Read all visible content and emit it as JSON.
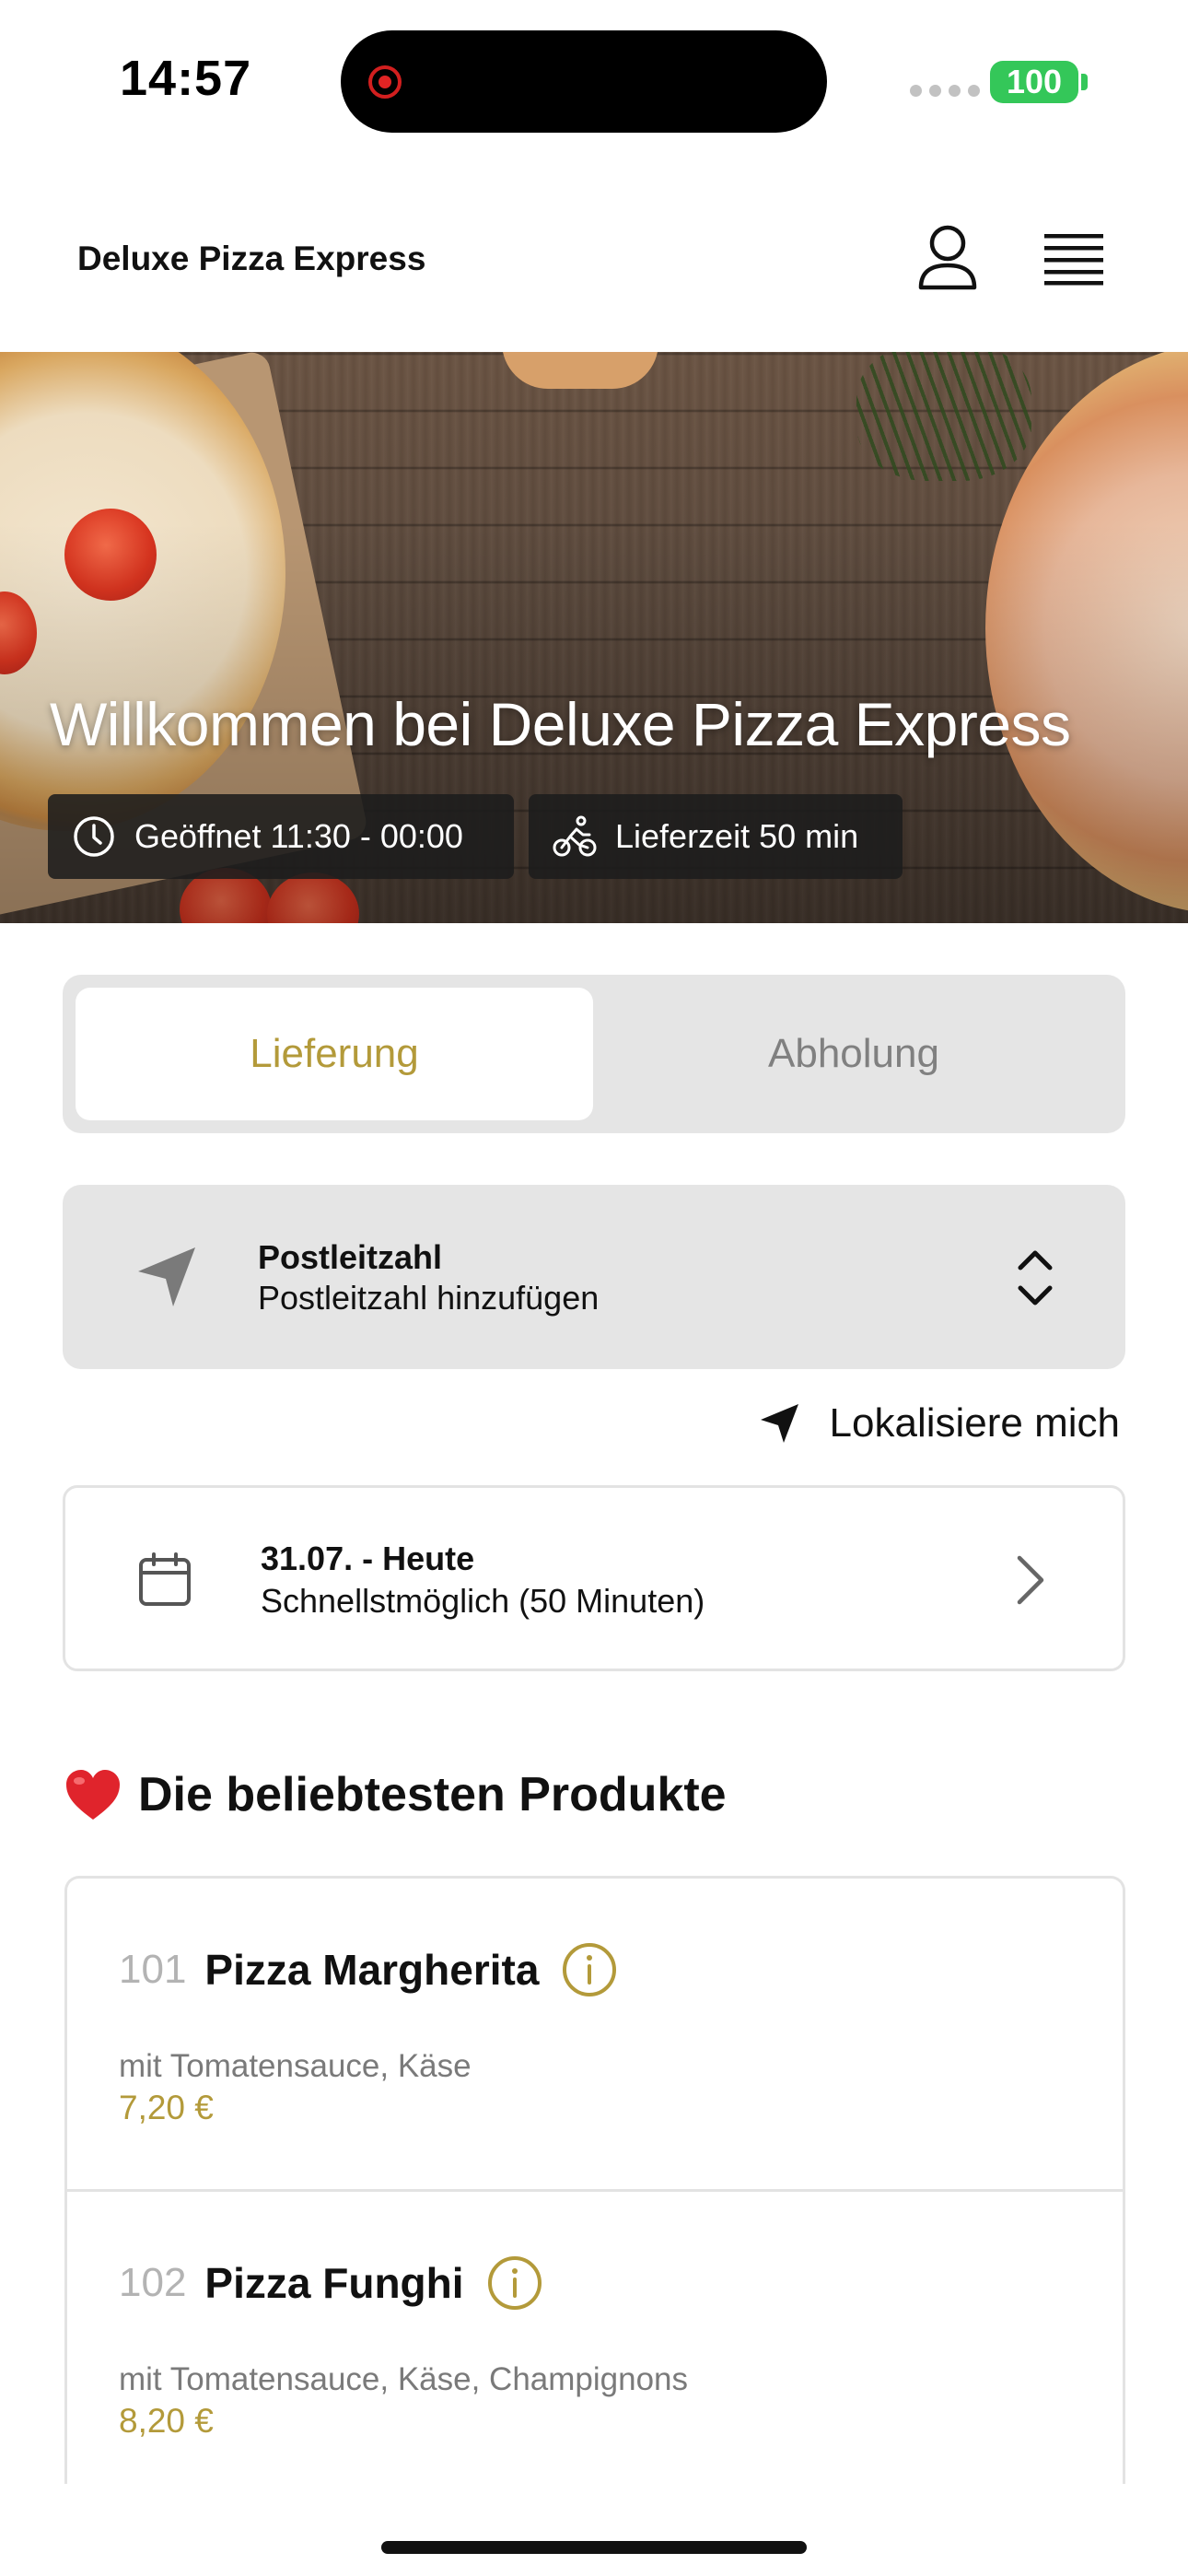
{
  "status_bar": {
    "time": "14:57",
    "battery": "100",
    "recording_icon": "screen-recording-icon"
  },
  "header": {
    "title": "Deluxe Pizza Express",
    "account_icon": "user-icon",
    "menu_icon": "hamburger-menu-icon"
  },
  "hero": {
    "title": "Willkommen bei Deluxe Pizza Express",
    "opening_hours": "Geöffnet 11:30 - 00:00",
    "delivery_time": "Lieferzeit 50 min"
  },
  "order_mode": {
    "tabs": [
      {
        "label": "Lieferung",
        "selected": true
      },
      {
        "label": "Abholung",
        "selected": false
      }
    ]
  },
  "postcode": {
    "label": "Postleitzahl",
    "value": "Postleitzahl hinzufügen"
  },
  "locate": {
    "label": "Lokalisiere mich"
  },
  "schedule": {
    "date": "31.07. - Heute",
    "time": "Schnellstmöglich (50 Minuten)"
  },
  "popular": {
    "title": "Die beliebtesten Produkte",
    "products": [
      {
        "number": "101",
        "name": "Pizza Margherita",
        "description": "mit Tomatensauce, Käse",
        "price": "7,20 €"
      },
      {
        "number": "102",
        "name": "Pizza Funghi",
        "description": "mit Tomatensauce, Käse, Champignons",
        "price": "8,20 €"
      }
    ]
  },
  "colors": {
    "accent": "#b39a3a",
    "panel": "#e5e5e5",
    "muted_text": "#7a7a7a",
    "battery": "#34c759"
  }
}
